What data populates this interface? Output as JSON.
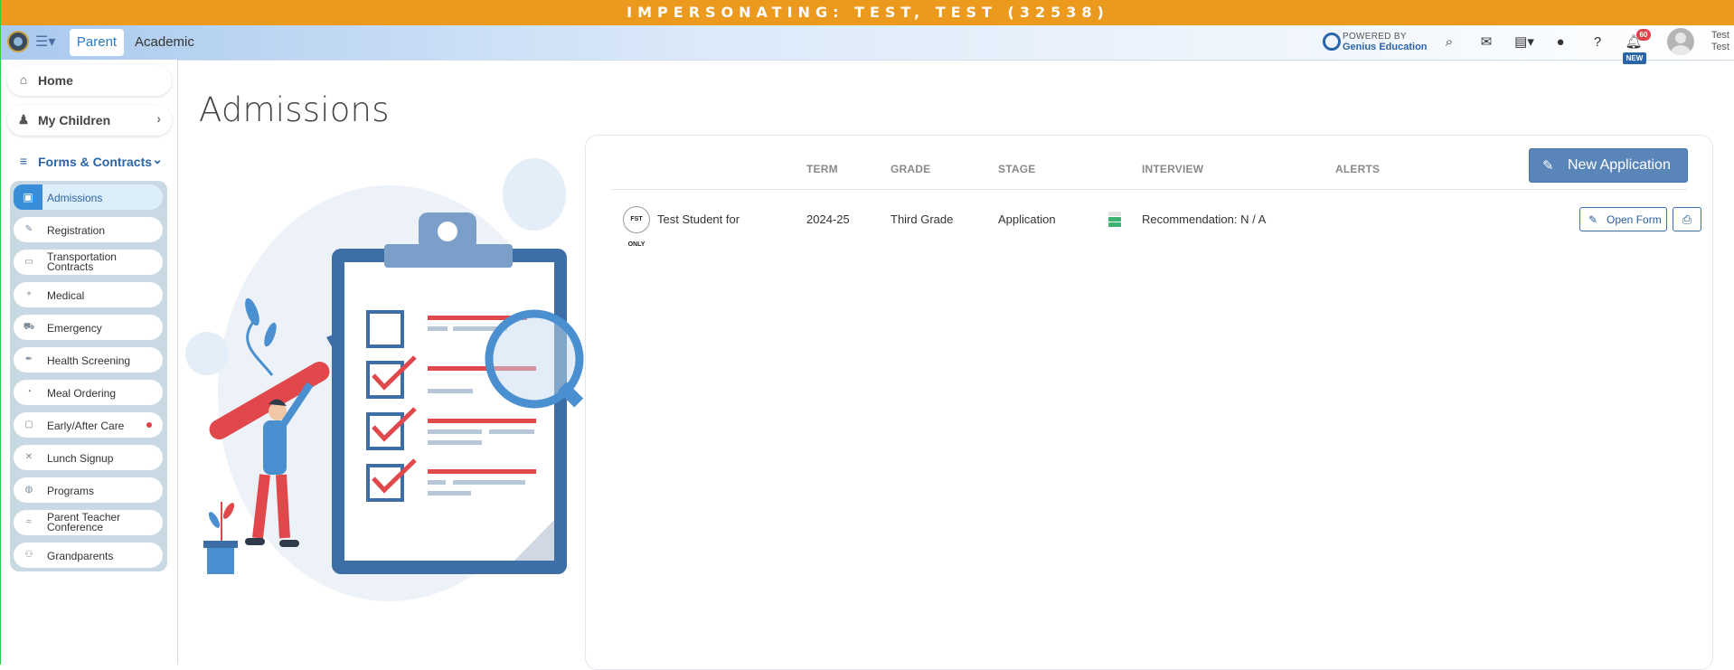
{
  "banner": {
    "text": "IMPERSONATING: TEST, TEST (32538)"
  },
  "topnav": {
    "tabs": [
      "Parent",
      "Academic"
    ],
    "powered_line1": "POWERED BY",
    "powered_line2": "Genius Education",
    "notification_count": "60",
    "new_tag": "NEW",
    "user_first": "Test",
    "user_last": "Test"
  },
  "sidebar": {
    "home": "Home",
    "my_children": "My Children",
    "forms_contracts": "Forms & Contracts",
    "items": [
      {
        "label": "Admissions",
        "icon": "clipboard-icon"
      },
      {
        "label": "Registration",
        "icon": "edit-form-icon"
      },
      {
        "label": "Transportation Contracts",
        "icon": "bus-icon"
      },
      {
        "label": "Medical",
        "icon": "medical-icon"
      },
      {
        "label": "Emergency",
        "icon": "ambulance-icon"
      },
      {
        "label": "Health Screening",
        "icon": "pen-icon"
      },
      {
        "label": "Meal Ordering",
        "icon": "meal-icon"
      },
      {
        "label": "Early/After Care",
        "icon": "calendar-icon"
      },
      {
        "label": "Lunch Signup",
        "icon": "utensils-icon"
      },
      {
        "label": "Programs",
        "icon": "person-icon"
      },
      {
        "label": "Parent Teacher Conference",
        "icon": "handshake-icon"
      },
      {
        "label": "Grandparents",
        "icon": "people-icon"
      }
    ]
  },
  "main": {
    "title": "Admissions",
    "new_application": "New Application",
    "columns": [
      "TERM",
      "GRADE",
      "STAGE",
      "INTERVIEW",
      "ALERTS"
    ],
    "rows": [
      {
        "student_logo": "FST ONLY",
        "student": "Test Student for",
        "term": "2024-25",
        "grade": "Third Grade",
        "stage": "Application",
        "interview": "Recommendation: N / A",
        "open_form": "Open Form"
      }
    ]
  },
  "colors": {
    "banner": "#eb9a1e",
    "accent": "#2a65a8",
    "button": "#5a85b9",
    "stage_green": "#3cb371"
  }
}
